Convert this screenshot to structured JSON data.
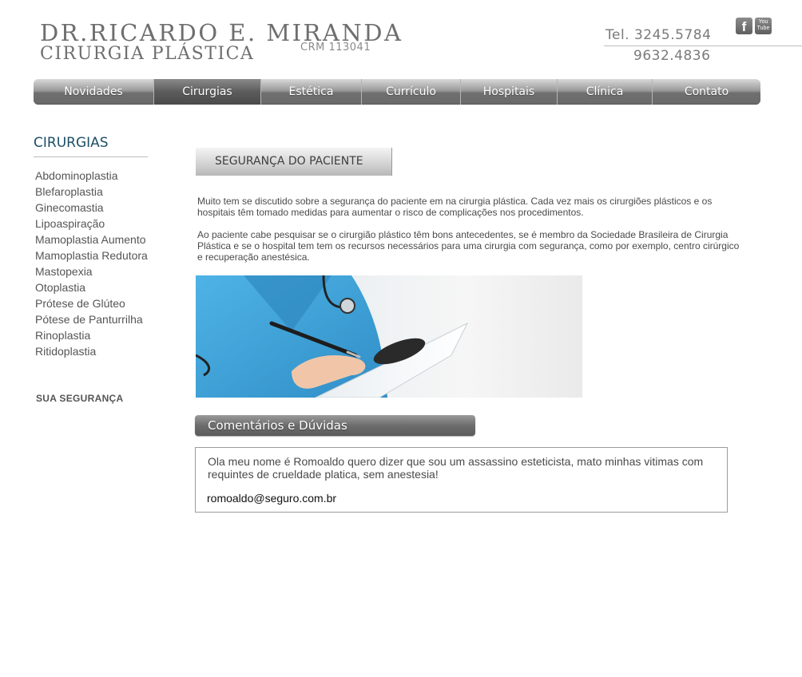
{
  "header": {
    "logo_name": "DR.RICARDO E. MIRANDA",
    "logo_specialty": "CIRURGIA PLÁSTICA",
    "logo_crm": "CRM 113041",
    "phone_1": "Tel. 3245.5784",
    "phone_2": "9632.4836",
    "social": {
      "facebook_label": "f",
      "youtube_label": "You Tube"
    }
  },
  "nav": {
    "items": [
      {
        "label": "Novidades"
      },
      {
        "label": "Cirurgias"
      },
      {
        "label": "Estética"
      },
      {
        "label": "Currículo"
      },
      {
        "label": "Hospitais"
      },
      {
        "label": "Clínica"
      },
      {
        "label": "Contato"
      }
    ],
    "active": "Cirurgias"
  },
  "sidebar": {
    "title": "CIRURGIAS",
    "items": [
      {
        "label": "Abdominoplastia"
      },
      {
        "label": "Blefaroplastia"
      },
      {
        "label": "Ginecomastia"
      },
      {
        "label": "Lipoaspiração"
      },
      {
        "label": "Mamoplastia Aumento"
      },
      {
        "label": "Mamoplastia Redutora"
      },
      {
        "label": "Mastopexia"
      },
      {
        "label": "Otoplastia"
      },
      {
        "label": "Prótese de Glúteo"
      },
      {
        "label": "Pótese de Panturrilha"
      },
      {
        "label": "Rinoplastia"
      },
      {
        "label": "Ritidoplastia"
      }
    ],
    "extra_link": "SUA SEGURANÇA"
  },
  "main": {
    "section_title": "SEGURANÇA DO PACIENTE",
    "paragraph_1": "Muito tem se discutido sobre a segurança do paciente em na cirurgia plástica. Cada vez mais os cirurgiões plásticos e os hospitais têm tomado medidas para aumentar o risco de complicações nos procedimentos.",
    "paragraph_2": "Ao paciente cabe pesquisar se o cirurgião plástico têm bons antecedentes, se é membro da Sociedade Brasileira de Cirurgia Plástica e se o hospital tem tem os recursos necessários para uma cirurgia com segurança, como por exemplo, centro cirúrgico e recuperação anestésica.",
    "comments_title": "Comentários e Dúvidas",
    "comment": {
      "text": "Ola meu nome é Romoaldo quero dizer que sou um assassino esteticista, mato minhas vitimas com requintes de crueldade platica, sem anestesia!",
      "email": "romoaldo@seguro.com.br"
    }
  },
  "colors": {
    "nav_gray": "#6f6f6f",
    "sidebar_title": "#1e4f66",
    "scrub_blue": "#3ea3d9"
  }
}
